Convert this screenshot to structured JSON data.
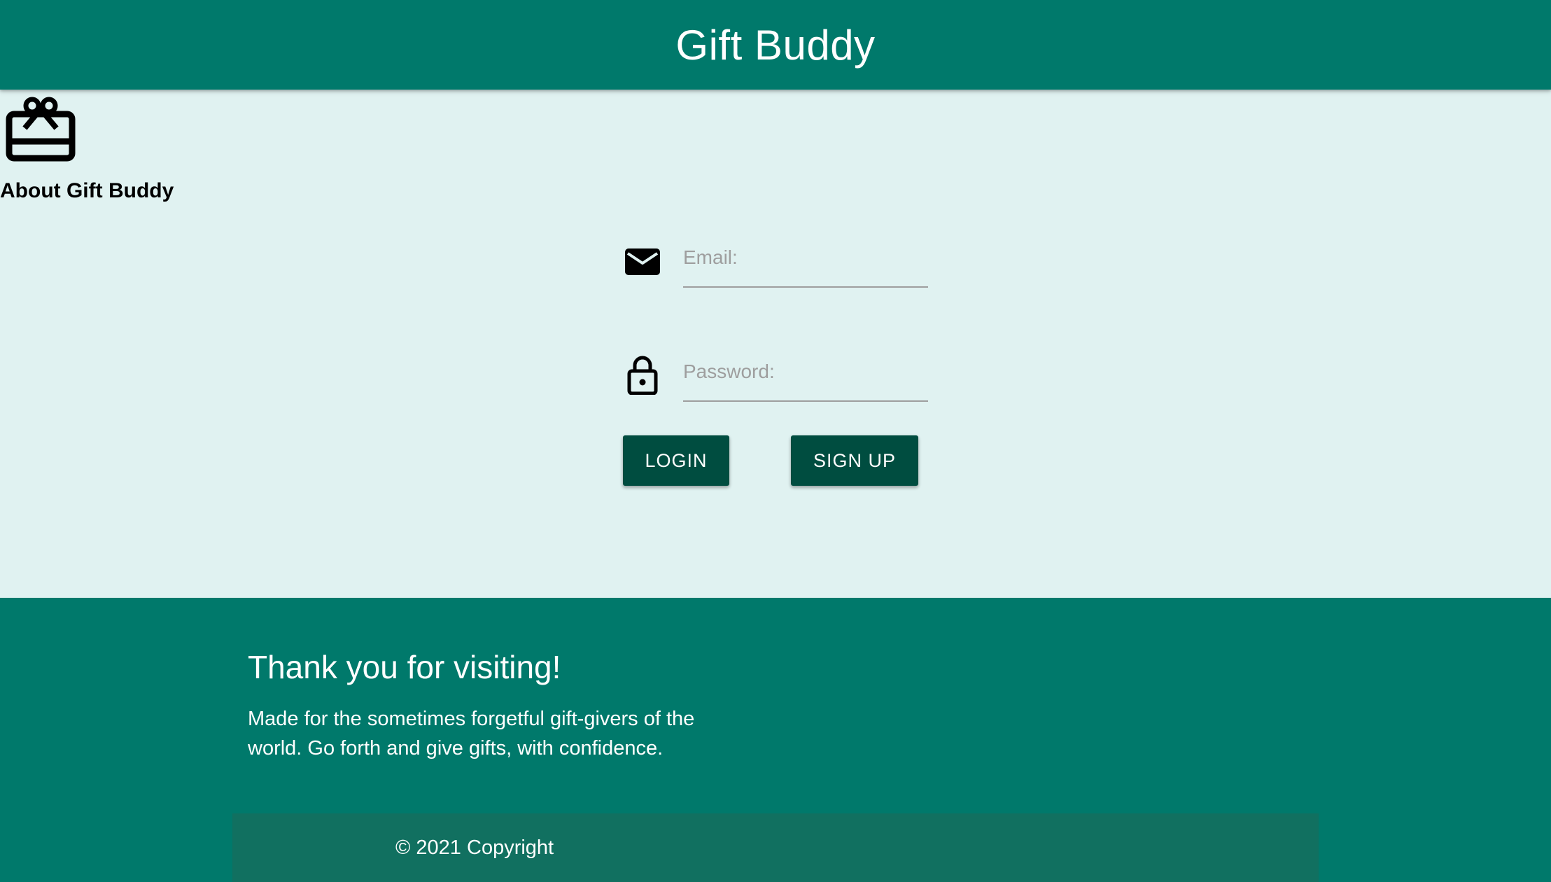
{
  "header": {
    "title": "Gift Buddy"
  },
  "about": {
    "icon": "gift-card-icon",
    "label": "About Gift Buddy"
  },
  "login_form": {
    "email": {
      "icon": "mail-icon",
      "placeholder": "Email:",
      "value": ""
    },
    "password": {
      "icon": "lock-icon",
      "placeholder": "Password:",
      "value": ""
    },
    "login_label": "LOGIN",
    "signup_label": "SIGN UP"
  },
  "footer": {
    "title": "Thank you for visiting!",
    "text": "Made for the sometimes forgetful gift-givers of the world. Go forth and give gifts, with confidence.",
    "copyright": "© 2021 Copyright"
  },
  "colors": {
    "primary": "#00796b",
    "button": "#004d40",
    "background": "#e0f2f1",
    "copyright_bar": "#117060"
  }
}
